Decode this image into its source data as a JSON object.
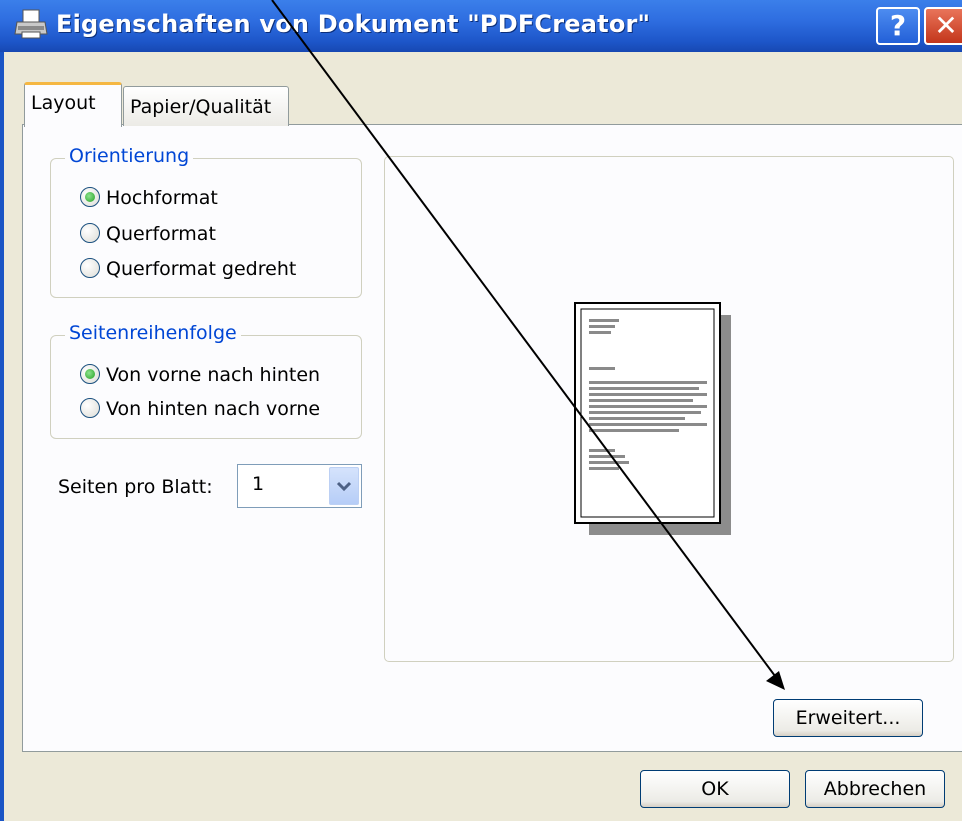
{
  "window": {
    "title": "Eigenschaften von Dokument \"PDFCreator\"",
    "help_glyph": "?",
    "close_glyph": "✕",
    "icon": "printer-icon"
  },
  "tabs": [
    {
      "label": "Layout",
      "active": true
    },
    {
      "label": "Papier/Qualität",
      "active": false
    }
  ],
  "orientation": {
    "legend": "Orientierung",
    "options": [
      {
        "label": "Hochformat",
        "checked": true
      },
      {
        "label": "Querformat",
        "checked": false
      },
      {
        "label": "Querformat gedreht",
        "checked": false
      }
    ]
  },
  "page_order": {
    "legend": "Seitenreihenfolge",
    "options": [
      {
        "label": "Von vorne nach hinten",
        "checked": true
      },
      {
        "label": "Von hinten nach vorne",
        "checked": false
      }
    ]
  },
  "pages_per_sheet": {
    "label": "Seiten pro Blatt:",
    "value": "1"
  },
  "buttons": {
    "advanced": "Erweitert...",
    "ok": "OK",
    "cancel": "Abbrechen"
  },
  "colors": {
    "titlebar": "#1d56c9",
    "dialog_bg": "#ece9d8",
    "legend_text": "#0046d5",
    "active_tab_highlight": "#f5b742"
  }
}
